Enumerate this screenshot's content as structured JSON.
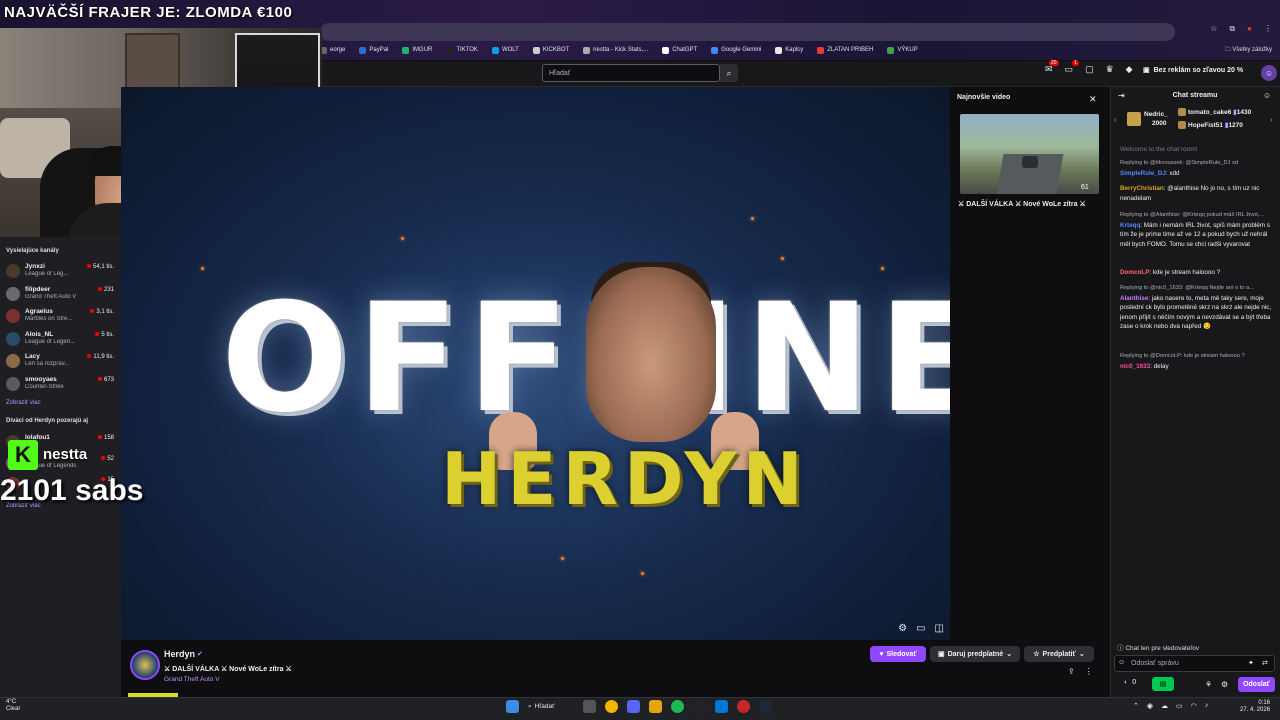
{
  "overlay": {
    "title": "NAJVÄČŠÍ FRAJER JE: ZLOMDA  €100",
    "kick_name": "nestta",
    "sub_count": "2101 sabs"
  },
  "browser": {
    "bookmarks": [
      {
        "label": "eorge",
        "color": "#666666"
      },
      {
        "label": "PayPal",
        "color": "#2c6ecb"
      },
      {
        "label": "IMGUR",
        "color": "#1bb76e"
      },
      {
        "label": "TIKTOK",
        "color": "#222222"
      },
      {
        "label": "WOLT",
        "color": "#00a2e8"
      },
      {
        "label": "KICKBOT",
        "color": "#cccccc"
      },
      {
        "label": "nestta - Kick Stats,...",
        "color": "#aaaaaa"
      },
      {
        "label": "ChatGPT",
        "color": "#ffffff"
      },
      {
        "label": "Google Gemini",
        "color": "#4285f4"
      },
      {
        "label": "Kaplcy",
        "color": "#e8e8e8"
      },
      {
        "label": "ZLATAN PRIBEH",
        "color": "#e53935"
      },
      {
        "label": "VÝKUP",
        "color": "#43a047"
      }
    ],
    "all_bookmarks": "Všetky záložky"
  },
  "header": {
    "search_placeholder": "Hľadať",
    "notif_count": "20",
    "inbox_count": "1",
    "ad_free": "Bez reklám so zľavou 20 %"
  },
  "sidebar": {
    "live_title": "Vysielajúce kanály",
    "channels": [
      {
        "name": "Jynxzi",
        "game": "League of Leg...",
        "viewers": "54,1 tis."
      },
      {
        "name": "filipdeer",
        "game": "Grand Theft Auto V",
        "viewers": "231"
      },
      {
        "name": "Agraelus",
        "game": "Marbles on Stre...",
        "viewers": "3,1 tis."
      },
      {
        "name": "Alois_NL",
        "game": "League of Legen...",
        "viewers": "5 tis."
      },
      {
        "name": "Lacy",
        "game": "Len sa rozpráv...",
        "viewers": "11,9 tis."
      },
      {
        "name": "smooyaes",
        "game": "Counter-Strike",
        "viewers": "673"
      }
    ],
    "show_more": "Zobraziť viac",
    "watchers_title": "Diváci od Herdyn pozerajú aj",
    "watch_channels": [
      {
        "name": "lolafou1",
        "game": "",
        "viewers": "158"
      },
      {
        "name": "",
        "game": "League of Legends",
        "viewers": "52"
      },
      {
        "name": "",
        "game": "",
        "viewers": "15"
      }
    ],
    "show_more_2": "Zobraziť viac"
  },
  "player": {
    "offline_text": "OFFLINE",
    "logo_text": "HERDYN"
  },
  "latest": {
    "title": "Najnovšie video",
    "duration": "61",
    "caption": "⚔ DALŠÍ VÁLKA ⚔ Nové WoLe zítra ⚔"
  },
  "chat": {
    "title": "Chat streamu",
    "gifters": [
      {
        "name": "Nedric_",
        "count": "2000"
      },
      {
        "name": "tomato_cake6",
        "count": "1430"
      },
      {
        "name": "HopeFist51",
        "count": "1270"
      }
    ],
    "welcome": "Welcome to the chat room!",
    "messages": [
      {
        "reply": "Replying to @tikvoussek: @SimpleRule_DJ xd",
        "user": "SimpleRule_DJ",
        "text": "xdd",
        "cls": "u1"
      },
      {
        "reply": "",
        "user": "BerryChristian",
        "text": "@alanthise No jo no, s tím uz nic nenadelam",
        "cls": "u2"
      },
      {
        "reply": "Replying to @Alanthise: @Krteqq pokud máš IRL život,...",
        "user": "Krteqq",
        "text": "Mám i nemám IRL život, spíš mám problém s tím že je prime time až ve 12 a pokud bych už nehrál měl bych FOMO. Tomu se chci radši vyvarovat",
        "cls": "u1"
      },
      {
        "reply": "",
        "user": "DomcoLP",
        "text": "kde je stream haloooo ?",
        "cls": "u3"
      },
      {
        "reply": "Replying to @nic0_1633: @Krteqq Nejde ani o to a...",
        "user": "Alanthise",
        "text": "jako nasere to, meta mě taky sere, moje poslední ck bylo prometěné skrz na skrz ale nejde nic, jenom přijít s něčím novým a nevzdávat se a být třeba zase o krok nebo dva napřed 😏",
        "cls": "u4"
      },
      {
        "reply": "Replying to @DomcoLP: kde je stream haloooo ?",
        "user": "nic0_1633",
        "text": "delay",
        "cls": "u5"
      }
    ],
    "followers_only": "Chat len pre sledovateľov",
    "input_placeholder": "Odoslať správu",
    "points": "0",
    "send_label": "Odoslať"
  },
  "stream": {
    "name": "Herdyn",
    "title": "⚔ DALŠÍ VÁLKA ⚔ Nové WoLe zítra ⚔",
    "game": "Grand Theft Auto V",
    "follow_label": "Sledovať",
    "gift_label": "Daruj predplatné",
    "subscribe_label": "Predplatiť"
  },
  "taskbar": {
    "weather_temp": "4°C",
    "weather_desc": "Clear",
    "search_label": "Hľadať",
    "time": "0:16",
    "date": "27. 4. 2026"
  }
}
